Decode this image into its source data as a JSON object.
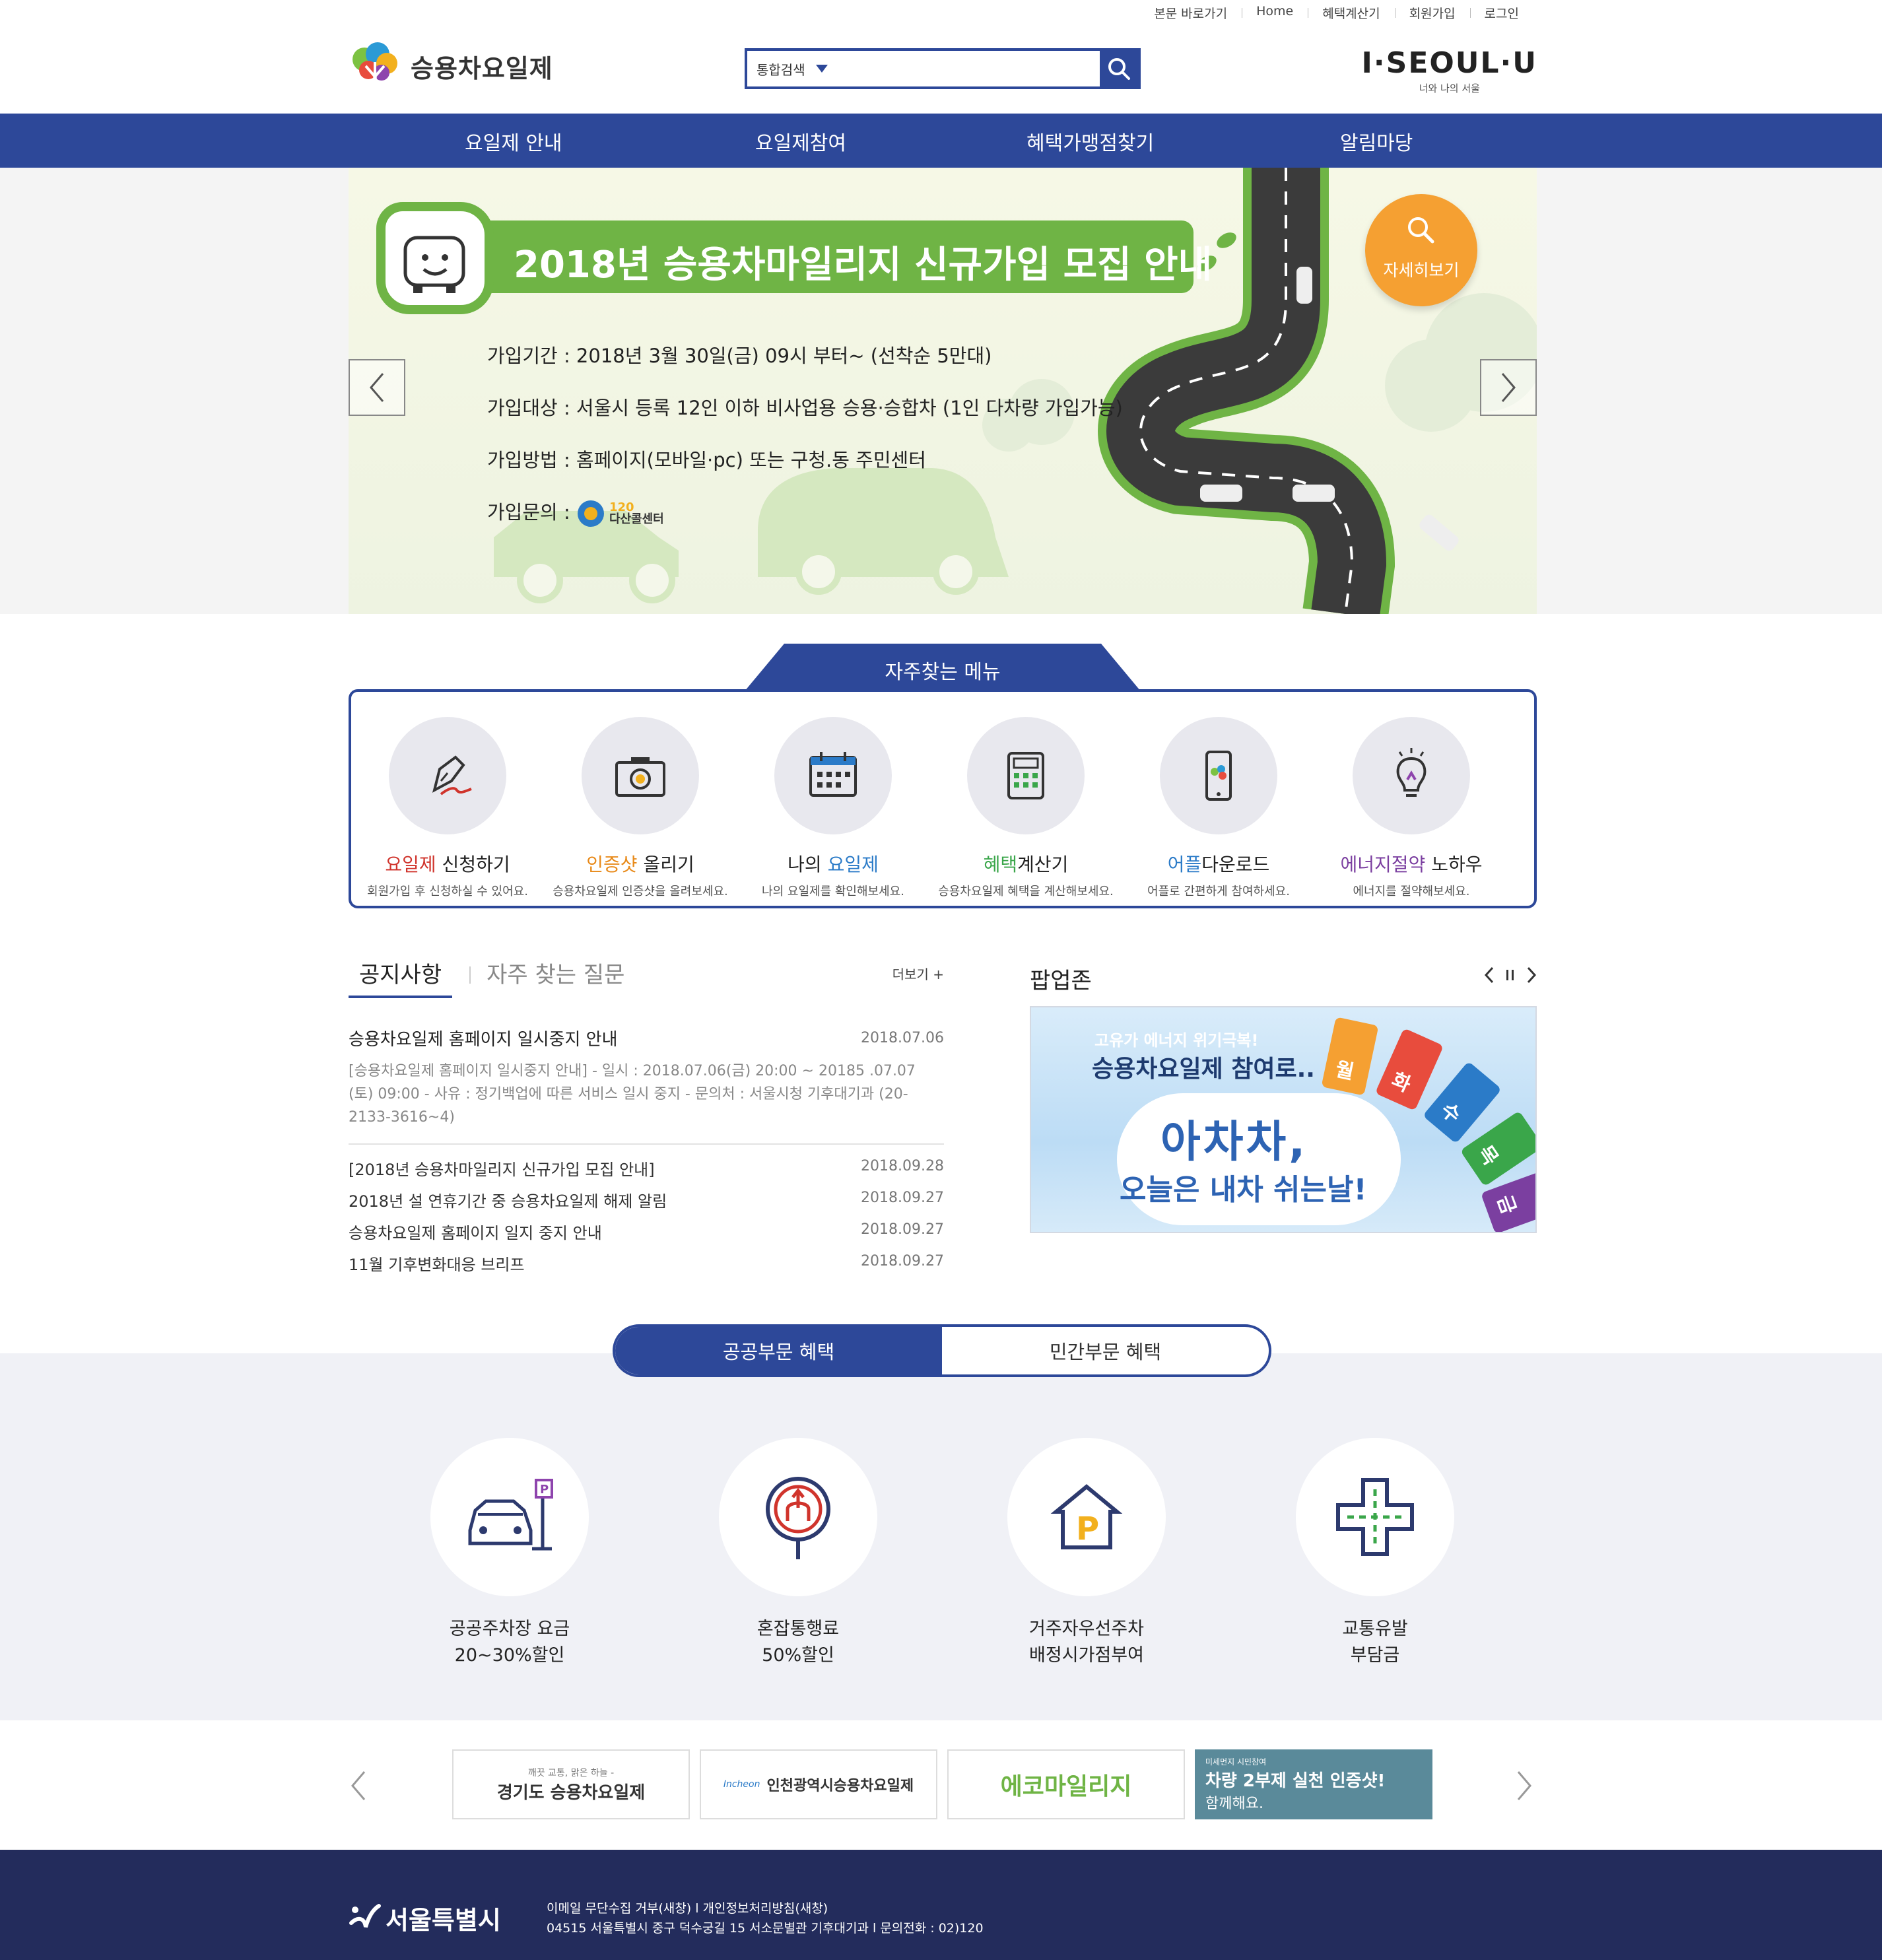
{
  "util_links": [
    "본문 바로가기",
    "Home",
    "혜택계산기",
    "회원가입",
    "로그인"
  ],
  "logo": {
    "text": "승용차요일제"
  },
  "search": {
    "category": "통합검색",
    "placeholder": ""
  },
  "seoul": {
    "logo": "I·SEOUL·U",
    "tagline": "너와 나의 서울"
  },
  "nav": [
    "요일제 안내",
    "요일제참여",
    "혜택가맹점찾기",
    "알림마당"
  ],
  "banner": {
    "title": "2018년 승용차마일리지 신규가입 모집 안내",
    "lines": [
      "가입기간 : 2018년 3월 30일(금) 09시 부터~ (선착순 5만대)",
      "가입대상 : 서울시 등록 12인 이하 비사업용 승용·승합차 (1인 다차량 가입가능)",
      "가입방법 : 홈페이지(모바일·pc) 또는 구청.동 주민센터",
      "가입문의 :"
    ],
    "callcenter": "다산콜센터",
    "callcenter_num": "120",
    "more": "자세히보기"
  },
  "quick_menu": {
    "title": "자주찾는 메뉴",
    "items": [
      {
        "hl": "요일제",
        "rest": " 신청하기",
        "hl_color": "#d0342c",
        "desc": "회원가입 후 신청하실 수 있어요.",
        "icon": "pen-icon"
      },
      {
        "hl": "인증샷",
        "rest": " 올리기",
        "hl_color": "#e88a1a",
        "desc": "승용차요일제 인증샷을 올려보세요.",
        "icon": "camera-icon"
      },
      {
        "hl": "나의 ",
        "rest": "요일제",
        "hl_color": "#222",
        "rest_color": "#2b7bc8",
        "desc": "나의 요일제를 확인해보세요.",
        "icon": "calendar-icon"
      },
      {
        "hl": "혜택",
        "rest": "계산기",
        "hl_color": "#3aa64a",
        "desc": "승용차요일제 혜택을 계산해보세요.",
        "icon": "calculator-icon"
      },
      {
        "hl": "어플",
        "rest": "다운로드",
        "hl_color": "#2b7bc8",
        "desc": "어플로 간편하게 참여하세요.",
        "icon": "smartphone-icon"
      },
      {
        "hl": "에너지절약",
        "rest": " 노하우",
        "hl_color": "#7b3fa0",
        "desc": "에너지를 절약해보세요.",
        "icon": "lightbulb-icon"
      }
    ]
  },
  "notice": {
    "tab_active": "공지사항",
    "tab_inactive": "자주 찾는 질문",
    "more": "더보기 +",
    "first": {
      "title": "승용차요일제 홈페이지 일시중지 안내",
      "date": "2018.07.06",
      "summary": "[승용차요일제 홈페이지 일시중지 안내] - 일시 : 2018.07.06(금) 20:00 ~ 20185 .07.07 (토) 09:00 - 사유 : 정기백업에 따른 서비스 일시 중지 - 문의처 : 서울시청 기후대기과 (20-2133-3616~4)"
    },
    "list": [
      {
        "title": "[2018년 승용차마일리지 신규가입 모집 안내]",
        "date": "2018.09.28"
      },
      {
        "title": "2018년 설 연휴기간 중 승용차요일제 해제 알림",
        "date": "2018.09.27"
      },
      {
        "title": "승용차요일제 홈페이지 일지 중지 안내",
        "date": "2018.09.27"
      },
      {
        "title": "11월 기후변화대응 브리프",
        "date": "2018.09.27"
      }
    ]
  },
  "popup": {
    "title": "팝업존",
    "line1": "고유가 에너지 위기극복!",
    "line2": "승용차요일제 참여로..",
    "line3": "아차차,",
    "line4": "오늘은 내차 쉬는날!",
    "cards": [
      "월",
      "화",
      "수",
      "목",
      "금"
    ]
  },
  "benefits": {
    "tab_active": "공공부문 혜택",
    "tab_inactive": "민간부문 혜택",
    "items": [
      {
        "line1": "공공주차장 요금",
        "line2": "20~30%할인",
        "icon": "parking-car-icon"
      },
      {
        "line1": "혼잡통행료",
        "line2": "50%할인",
        "icon": "toll-icon"
      },
      {
        "line1": "거주자우선주차",
        "line2": "배정시가점부여",
        "icon": "resident-parking-icon"
      },
      {
        "line1": "교통유발",
        "line2": "부담금",
        "icon": "traffic-cross-icon"
      }
    ]
  },
  "partners": [
    {
      "top": "깨끗 교통, 맑은 하늘 -",
      "main": "경기도 승용차요일제"
    },
    {
      "top": "Incheon",
      "main": "인천광역시승용차요일제"
    },
    {
      "top": "",
      "main": "에코마일리지"
    },
    {
      "top": "미세먼지 시민참여",
      "main": "차량 2부제 실천 인증샷!",
      "sub": "함께해요."
    }
  ],
  "footer": {
    "logo": "서울특별시",
    "line1": "이메일 무단수집 거부(새창)  l  개인정보처리방침(새창)",
    "line2": "04515 서울특별시 중구 덕수궁길 15 서소문별관 기후대기과 l  문의전화 : 02)120"
  },
  "colors": {
    "primary": "#2d4899",
    "banner_green": "#6fb445",
    "more_orange": "#f5a032",
    "footer": "#232c5c"
  }
}
